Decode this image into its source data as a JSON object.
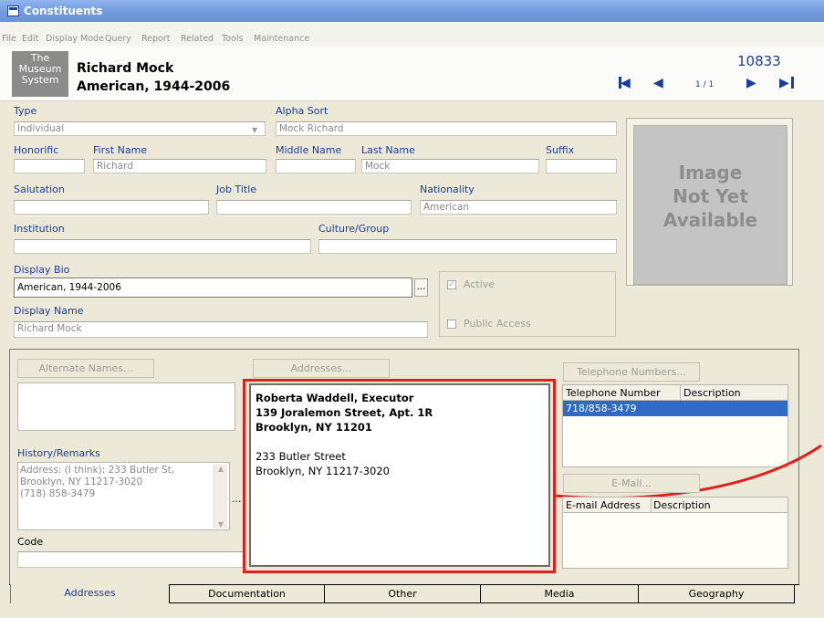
{
  "window": {
    "title": "Constituents"
  },
  "menu": [
    "File",
    "Edit",
    "Display Mode",
    "Query",
    "Report",
    "Related",
    "Tools",
    "Maintenance"
  ],
  "header": {
    "logo": [
      "The",
      "Museum",
      "System"
    ],
    "name": "Richard Mock",
    "bio": "American, 1944-2006",
    "id": "10833",
    "record_pos": "1 / 1"
  },
  "form": {
    "type_label": "Type",
    "type_value": "Individual",
    "alpha_label": "Alpha Sort",
    "alpha_value": "Mock Richard",
    "honorific_label": "Honorific",
    "honorific_value": "",
    "first_label": "First Name",
    "first_value": "Richard",
    "middle_label": "Middle Name",
    "middle_value": "",
    "last_label": "Last Name",
    "last_value": "Mock",
    "suffix_label": "Suffix",
    "suffix_value": "",
    "salutation_label": "Salutation",
    "salutation_value": "",
    "job_label": "Job Title",
    "job_value": "",
    "nationality_label": "Nationality",
    "nationality_value": "American",
    "institution_label": "Institution",
    "institution_value": "",
    "culture_label": "Culture/Group",
    "culture_value": "",
    "displaybio_label": "Display Bio",
    "displaybio_value": "American, 1944-2006",
    "displayname_label": "Display Name",
    "displayname_value": "Richard Mock",
    "active_label": "Active",
    "public_label": "Public Access",
    "ellipsis": "..."
  },
  "image_placeholder": [
    "Image",
    "Not Yet",
    "Available"
  ],
  "lower": {
    "alt_names_btn": "Alternate Names...",
    "addresses_btn": "Addresses...",
    "phones_btn": "Telephone Numbers...",
    "email_btn": "E-Mail...",
    "history_label": "History/Remarks",
    "history_lines": [
      "Address: (I think): 233 Butler St,",
      "Brooklyn, NY 11217-3020",
      "(718) 858-3479"
    ],
    "code_label": "Code",
    "address_bold": [
      "Roberta Waddell, Executor",
      "139 Joralemon Street, Apt. 1R",
      "Brooklyn, NY 11201"
    ],
    "address_plain": [
      "233 Butler Street",
      "Brooklyn, NY 11217-3020"
    ],
    "phone_cols": [
      "Telephone Number",
      "Description"
    ],
    "phone_rows": [
      "718/858-3479"
    ],
    "email_cols": [
      "E-mail Address",
      "Description"
    ]
  },
  "tabs": [
    "Addresses",
    "Documentation",
    "Other",
    "Media",
    "Geography"
  ],
  "colors": {
    "highlight": "#e0201c",
    "selection": "#316ac5",
    "label": "#1a3c9a"
  }
}
